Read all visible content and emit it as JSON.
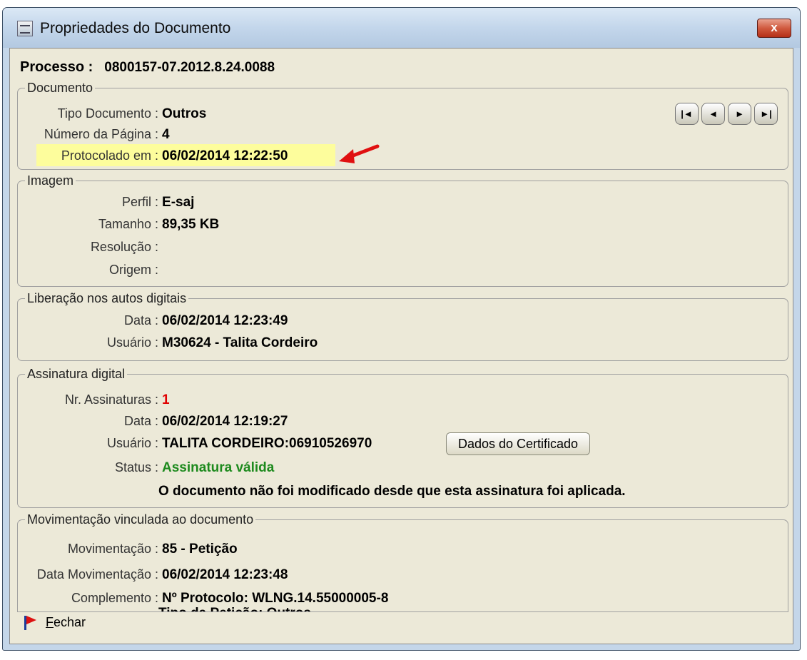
{
  "window": {
    "title": "Propriedades do Documento",
    "close_label": "x"
  },
  "processo": {
    "label": "Processo :",
    "value": "0800157-07.2012.8.24.0088"
  },
  "documento": {
    "legend": "Documento",
    "tipo_label": "Tipo Documento :",
    "tipo_value": "Outros",
    "pagina_label": "Número da Página :",
    "pagina_value": "4",
    "protocolado_label": "Protocolado em :",
    "protocolado_value": "06/02/2014 12:22:50",
    "nav": {
      "first": "|◄",
      "prev": "◄",
      "next": "►",
      "last": "►|"
    }
  },
  "imagem": {
    "legend": "Imagem",
    "perfil_label": "Perfil :",
    "perfil_value": "E-saj",
    "tamanho_label": "Tamanho :",
    "tamanho_value": "89,35 KB",
    "resolucao_label": "Resolução :",
    "origem_label": "Origem :"
  },
  "liberacao": {
    "legend": "Liberação nos autos digitais",
    "data_label": "Data :",
    "data_value": "06/02/2014 12:23:49",
    "usuario_label": "Usuário :",
    "usuario_value": "M30624 - Talita Cordeiro"
  },
  "assinatura": {
    "legend": "Assinatura digital",
    "nr_label": "Nr. Assinaturas :",
    "nr_value": "1",
    "data_label": "Data :",
    "data_value": "06/02/2014 12:19:27",
    "usuario_label": "Usuário :",
    "usuario_value": "TALITA CORDEIRO:06910526970",
    "certificado_button": "Dados do Certificado",
    "status_label": "Status :",
    "status_value": "Assinatura válida",
    "message": "O documento não foi modificado desde que esta assinatura foi aplicada."
  },
  "movimentacao": {
    "legend": "Movimentação vinculada ao documento",
    "mov_label": "Movimentação :",
    "mov_value": "85 - Petição",
    "data_label": "Data Movimentação :",
    "data_value": "06/02/2014 12:23:48",
    "compl_label": "Complemento :",
    "compl_value": "Nº Protocolo: WLNG.14.55000005-8",
    "compl_value2": "Tipo da Petição: Outros"
  },
  "footer": {
    "close_key": "F",
    "close_rest": "echar"
  },
  "colors": {
    "highlight": "#fdfd9c",
    "arrow": "#e01010",
    "valid": "#1d8a1d",
    "count": "#e00000"
  }
}
